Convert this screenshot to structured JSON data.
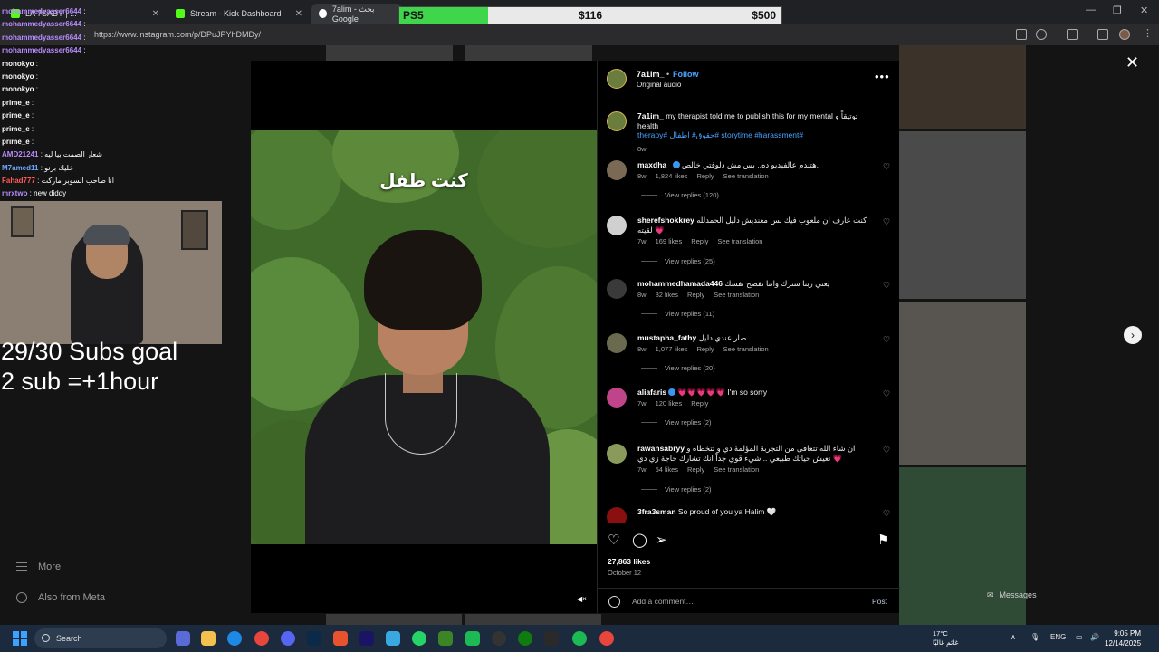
{
  "browser": {
    "tabs": [
      {
        "title": "LA 7SABY | ..."
      },
      {
        "title": "Stream - Kick Dashboard"
      },
      {
        "title": "7alim - بحث Google"
      }
    ],
    "url": "https://www.instagram.com/p/DPuJPYhDMDy/"
  },
  "goal": {
    "name": "PS5",
    "current": "$116",
    "target": "$500",
    "progress": 0.232
  },
  "chat": [
    {
      "user": "mohammedyasser6644",
      "msg": "",
      "color": "#b88cff"
    },
    {
      "user": "mohammedyasser6644",
      "msg": "",
      "color": "#b88cff"
    },
    {
      "user": "mohammedyasser6644",
      "msg": "",
      "color": "#b88cff"
    },
    {
      "user": "mohammedyasser6644",
      "msg": "",
      "color": "#b88cff"
    },
    {
      "user": "monokyo",
      "msg": "",
      "color": "#ffffff"
    },
    {
      "user": "monokyo",
      "msg": "",
      "color": "#ffffff"
    },
    {
      "user": "monokyo",
      "msg": "",
      "color": "#ffffff"
    },
    {
      "user": "prime_e",
      "msg": "",
      "color": "#ffffff"
    },
    {
      "user": "prime_e",
      "msg": "",
      "color": "#ffffff"
    },
    {
      "user": "prime_e",
      "msg": "",
      "color": "#ffffff"
    },
    {
      "user": "prime_e",
      "msg": "",
      "color": "#ffffff"
    },
    {
      "user": "AMD21241",
      "msg": "شعار الصمت بيا ليه",
      "color": "#b88cff"
    },
    {
      "user": "M7amed11",
      "msg": "خليك برنو",
      "color": "#6fa8ff"
    },
    {
      "user": "Fahad777",
      "msg": "انا صاحب السوبر ماركت",
      "color": "#ff5a5a"
    },
    {
      "user": "mrxtwo",
      "msg": "new diddy",
      "color": "#b88cff"
    }
  ],
  "stream": {
    "subs_goal": "29/30 Subs goal",
    "sub_rule": "2 sub =+1hour"
  },
  "ig_nav": {
    "more": "More",
    "meta": "Also from Meta"
  },
  "post": {
    "overlay_text": "كنت طفل",
    "author": "7a1im_",
    "dot": "•",
    "follow": "Follow",
    "audio": "Original audio",
    "caption": {
      "user": "7a1im_",
      "text": "my therapist told me to publish this for my mental توتيقاً و health",
      "tags": "therapy# حقوق# اطفال# storytime #harassment#",
      "age": "8w"
    },
    "comments": [
      {
        "user": "maxdha_",
        "verified": true,
        "text": "هتندم عالفيديو ده.. بس مش دلوقتي خالص.",
        "age": "8w",
        "likes": "1,824 likes",
        "reply": "Reply",
        "translate": "See translation",
        "replies": "View replies (120)",
        "color": "#7a6a55"
      },
      {
        "user": "sherefshokkrey",
        "verified": false,
        "text": "كنت عارف ان ملعوب فيك بس معنديش دليل الحمدلله لقيته 💗",
        "age": "7w",
        "likes": "169 likes",
        "reply": "Reply",
        "translate": "See translation",
        "replies": "View replies (25)",
        "color": "#d0d0d0"
      },
      {
        "user": "mohammedhamada446",
        "verified": false,
        "text": "يعني ربنا سترك وانتا تفضح نفسك",
        "age": "8w",
        "likes": "82 likes",
        "reply": "Reply",
        "translate": "See translation",
        "replies": "View replies (11)",
        "color": "#3a3a3a"
      },
      {
        "user": "mustapha_fathy",
        "verified": false,
        "text": "صار عندي دليل",
        "age": "8w",
        "likes": "1,077 likes",
        "reply": "Reply",
        "translate": "See translation",
        "replies": "View replies (20)",
        "color": "#6a6a50"
      },
      {
        "user": "aliafaris",
        "verified": true,
        "text": "💗💗💗💗💗 I'm so sorry",
        "age": "7w",
        "likes": "120 likes",
        "reply": "Reply",
        "translate": "",
        "replies": "View replies (2)",
        "color": "#c0448a"
      },
      {
        "user": "rawansabryy",
        "verified": false,
        "text": "ان شاء الله تتعافى من التجربة المؤلمة دي و تتخطاه و تعيش حياتك طبيعي .. شيء قوي جداً انك تشارك حاجة زي دي 💗",
        "age": "7w",
        "likes": "54 likes",
        "reply": "Reply",
        "translate": "See translation",
        "replies": "View replies (2)",
        "color": "#8a9a5a"
      },
      {
        "user": "3fra3sman",
        "verified": false,
        "text": "So proud of you ya Halim 🤍",
        "age": "",
        "likes": "",
        "reply": "",
        "translate": "",
        "replies": "",
        "color": "#8a1010"
      }
    ],
    "likes": "27,863 likes",
    "date": "October 12",
    "add_comment": "Add a comment…",
    "post_btn": "Post"
  },
  "side": {
    "messages": "Messages"
  },
  "taskbar": {
    "search": "Search",
    "weather_temp": "17°C",
    "weather_desc": "غائم غالبًا",
    "lang": "ENG",
    "time": "9:05 PM",
    "date": "12/14/2025"
  }
}
